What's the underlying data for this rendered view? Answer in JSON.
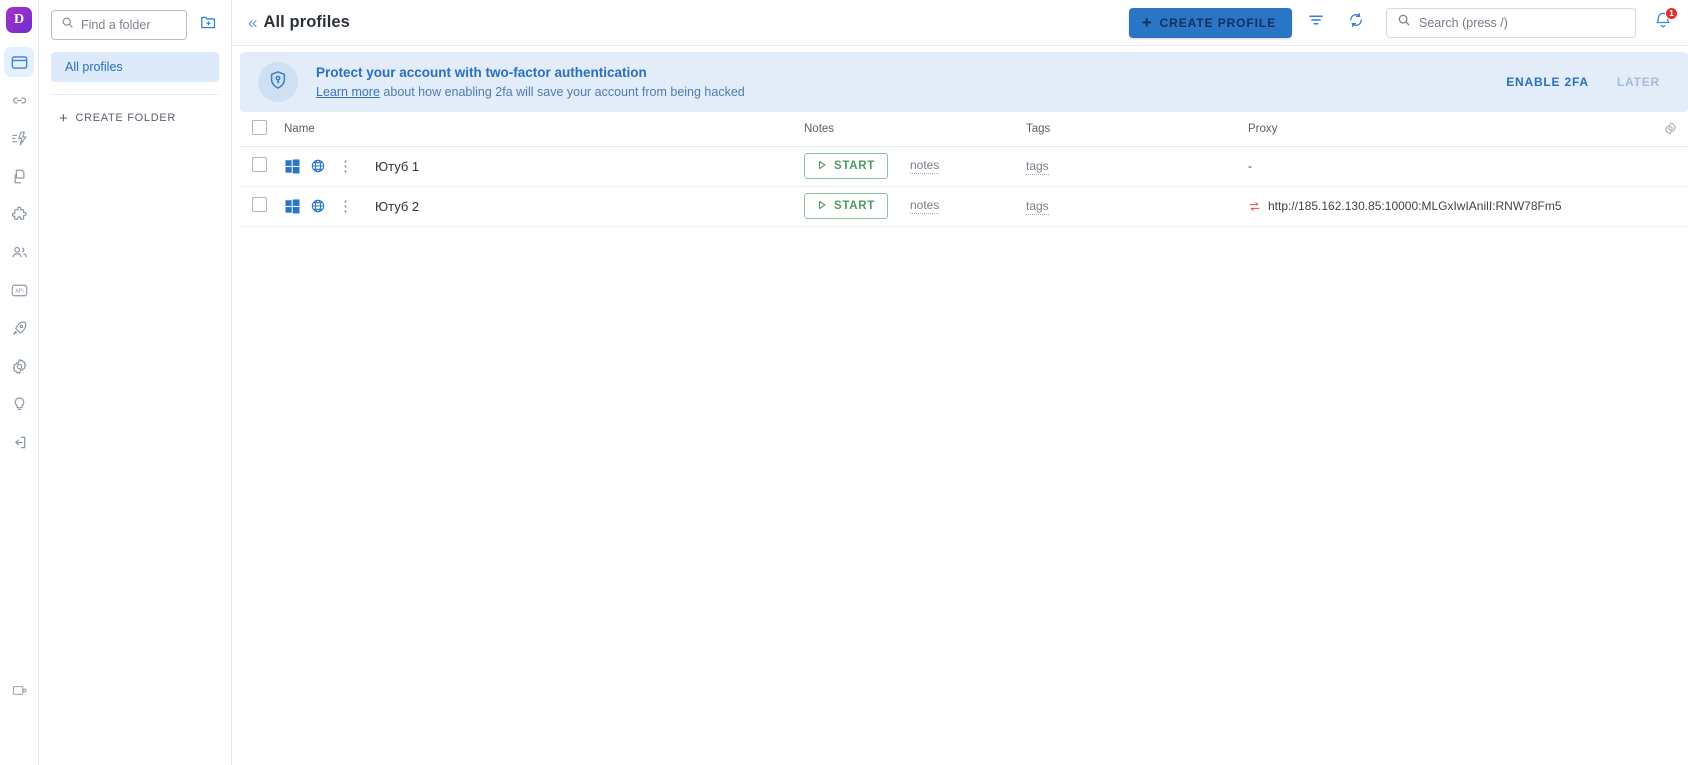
{
  "brand": {
    "logo_letter": "D"
  },
  "rail": {
    "items": [
      {
        "name": "profiles-icon",
        "title": "Profiles",
        "active": true
      },
      {
        "name": "proxy-link-icon",
        "title": "Proxies",
        "active": false
      },
      {
        "name": "automation-icon",
        "title": "Automation",
        "active": false
      },
      {
        "name": "cookies-icon",
        "title": "Cookies",
        "active": false
      },
      {
        "name": "extensions-icon",
        "title": "Extensions",
        "active": false
      },
      {
        "name": "team-icon",
        "title": "Team",
        "active": false
      },
      {
        "name": "api-icon",
        "title": "API",
        "active": false
      },
      {
        "name": "rocket-icon",
        "title": "Quick start",
        "active": false
      },
      {
        "name": "settings-gear-icon",
        "title": "Settings",
        "active": false
      },
      {
        "name": "lightbulb-icon",
        "title": "Tips",
        "active": false
      },
      {
        "name": "logout-icon",
        "title": "Log out",
        "active": false
      }
    ],
    "bottom_item": {
      "name": "window-mode-icon",
      "title": "Window mode"
    }
  },
  "sidebar": {
    "search_placeholder": "Find a folder",
    "new_folder_icon": "new-folder-icon",
    "folders": [
      {
        "label": "All profiles",
        "selected": true
      }
    ],
    "create_folder_label": "CREATE FOLDER",
    "create_folder_plus": "+"
  },
  "topbar": {
    "collapse_icon": "«",
    "title": "All profiles",
    "create_profile_label": "CREATE PROFILE",
    "create_profile_plus": "+",
    "filter_icon": "filter-icon",
    "refresh_icon": "refresh-icon",
    "search_placeholder": "Search (press /)",
    "search_value": "",
    "notification_count": "1"
  },
  "banner": {
    "icon": "shield-key-icon",
    "title": "Protect your account with two-factor authentication",
    "link_text": "Learn more",
    "subtitle_rest": " about how enabling 2fa will save your account from being hacked",
    "enable_label": "ENABLE 2FA",
    "later_label": "LATER"
  },
  "table": {
    "columns": [
      "",
      "Name",
      "",
      "Notes",
      "Tags",
      "Proxy",
      ""
    ],
    "headers": {
      "name": "Name",
      "notes": "Notes",
      "tags": "Tags",
      "proxy": "Proxy"
    },
    "settings_icon": "table-settings-gear-icon",
    "rows": [
      {
        "checked": false,
        "os_icon": "windows-icon",
        "browser_icon": "globe-icon",
        "menu_icon": "kebab-menu-icon",
        "name": "Ютуб 1",
        "start_label": "START",
        "notes": "notes",
        "tags": "tags",
        "proxy": "-",
        "proxy_has_icon": false
      },
      {
        "checked": false,
        "os_icon": "windows-icon",
        "browser_icon": "globe-icon",
        "menu_icon": "kebab-menu-icon",
        "name": "Ютуб 2",
        "start_label": "START",
        "notes": "notes",
        "tags": "tags",
        "proxy": "http://185.162.130.85:10000:MLGxIwIAnilI:RNW78Fm5",
        "proxy_has_icon": true
      }
    ]
  },
  "colors": {
    "accent_blue": "#2a75c6",
    "banner_bg": "#e2edf9",
    "start_green": "#4d9b62",
    "badge_red": "#e03030",
    "brand_purple": "#8b2fc9"
  }
}
